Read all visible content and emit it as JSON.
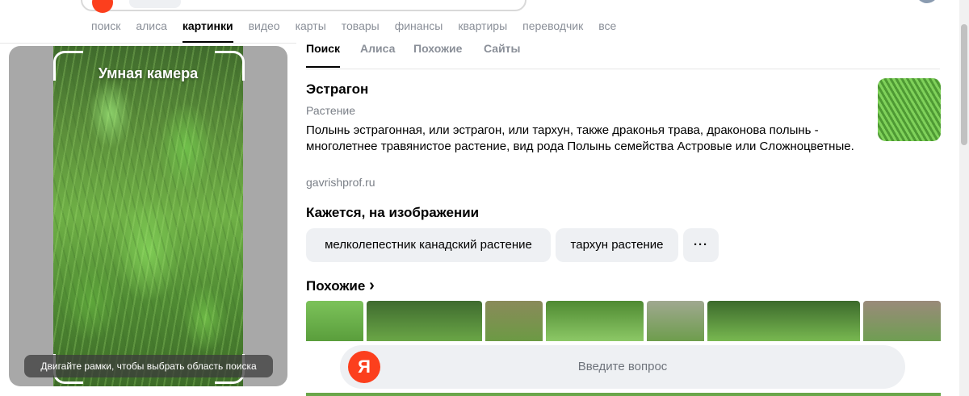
{
  "nav": {
    "items": [
      "поиск",
      "алиса",
      "картинки",
      "видео",
      "карты",
      "товары",
      "финансы",
      "квартиры",
      "переводчик",
      "все"
    ],
    "active": "картинки"
  },
  "camera": {
    "title": "Умная камера",
    "hint": "Двигайте рамки, чтобы выбрать область поиска"
  },
  "tabs": [
    "Поиск",
    "Алиса",
    "Похожие",
    "Сайты"
  ],
  "entity": {
    "title": "Эстрагон",
    "type": "Растение",
    "description": "Полынь эстрагонная, или эстрагон, или тархун, также драконья трава, драконова полынь - многолетнее травянистое растение, вид рода Полынь семейства Астровые или Сложноцветные.",
    "source": "gavrishprof.ru"
  },
  "detected": {
    "title": "Кажется, на изображении",
    "tags": [
      "мелколепестник канадский растение",
      "тархун растение"
    ],
    "more": "···"
  },
  "similar": {
    "title": "Похожие",
    "chevron": "›"
  },
  "ask": {
    "logo": "Я",
    "placeholder": "Введите вопрос"
  },
  "colors": {
    "brand": "#fc3f1d",
    "chip_bg": "#eef0f3",
    "muted_text": "#8a8f98"
  }
}
